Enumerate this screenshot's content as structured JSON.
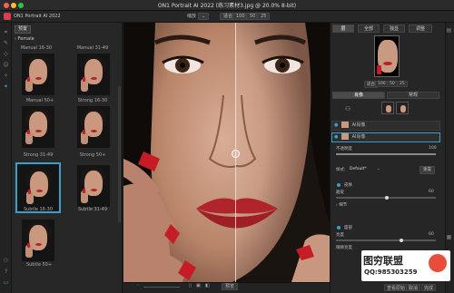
{
  "window": {
    "title": "ON1 Portrait AI 2022 (练习素材3.jpg @ 20.0% 8-bit)"
  },
  "app": {
    "name": "ON1 Portrait AI 2022"
  },
  "toolbar": {
    "zoom_label": "缩放",
    "zoom_options": [
      "适合",
      "100",
      "50",
      "25"
    ]
  },
  "presets": {
    "tab": "预置",
    "category": "Female",
    "items": [
      {
        "label": "Manual 16-30"
      },
      {
        "label": "Manual 31-49"
      },
      {
        "label": "Manual 50+"
      },
      {
        "label": "Strong 16-30"
      },
      {
        "label": "Strong 31-49"
      },
      {
        "label": "Strong 50+"
      },
      {
        "label": "Subtle 16-30",
        "selected": true
      },
      {
        "label": "Subtle 31-49"
      },
      {
        "label": "Subtle 50+"
      }
    ]
  },
  "bottom": {
    "preview_label": "预览",
    "cancel": "取消",
    "done": "完成",
    "more": "查看原始"
  },
  "right": {
    "top_tabs": [
      "层",
      "全部",
      "独显",
      "调整"
    ],
    "zoom_buttons": [
      "适合",
      "100",
      "50",
      "25"
    ],
    "sub_tabs": [
      "肖像",
      "常规"
    ],
    "layers": [
      {
        "label": "AI肖像"
      },
      {
        "label": "AI肖像"
      }
    ],
    "opacity_label": "不透明度",
    "opacity_value": "100",
    "style_label": "样式:",
    "style_value": "Default*",
    "reset_label": "重置",
    "skin_label": "皮肤",
    "skin_sub": "磨皮",
    "skin_value": "60",
    "detail_label": "细节",
    "face_label": "面部",
    "face_sub": "亮度",
    "face_value": "60",
    "face_sub2": "眼睛亮度"
  },
  "watermark": {
    "line1": "图穷联盟",
    "line2": "QQ:985303259"
  },
  "colors": {
    "accent": "#3aa0c8",
    "lips": "#b0242b",
    "nails": "#c61c25"
  }
}
